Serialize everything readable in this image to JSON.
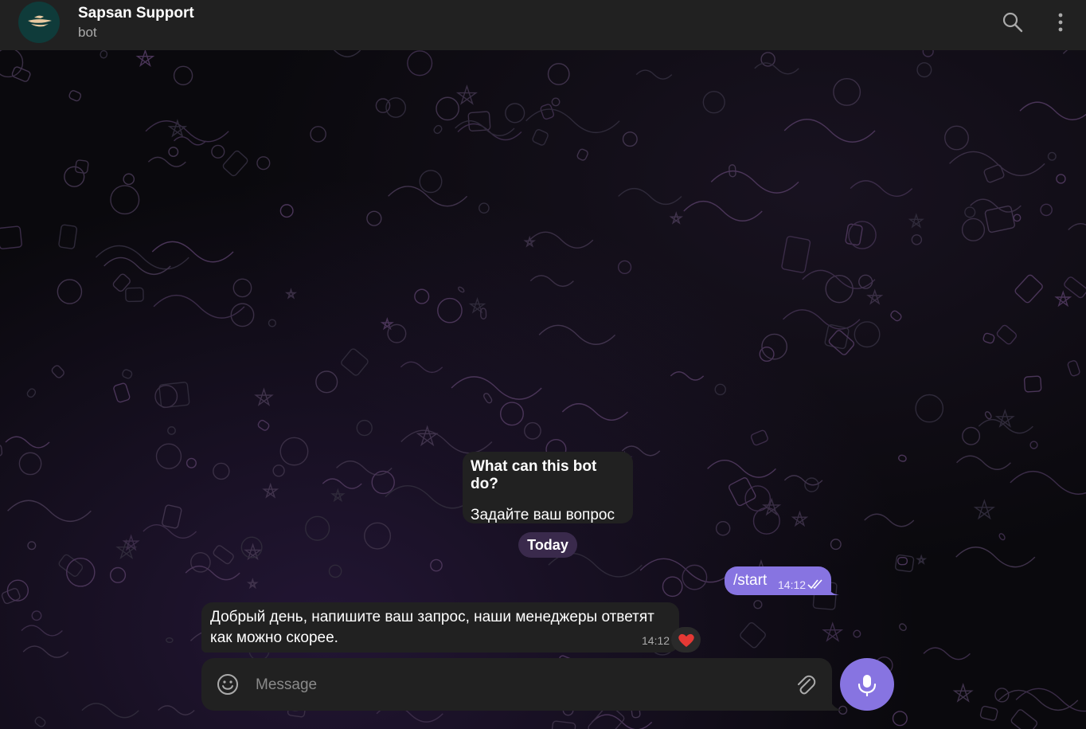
{
  "header": {
    "title": "Sapsan Support",
    "subtitle": "bot",
    "avatar_icon": "falcon-logo-icon",
    "search_icon": "search-icon",
    "menu_icon": "more-vertical-icon"
  },
  "bot_info": {
    "question": "What can this bot do?",
    "answer": "Задайте ваш вопрос"
  },
  "date_separator": "Today",
  "messages": [
    {
      "direction": "outgoing",
      "text": "/start",
      "time": "14:12",
      "status": "read-double-check"
    },
    {
      "direction": "incoming",
      "text": "Добрый день, напишите ваш запрос, наши менеджеры ответят как можно скорее.",
      "time": "14:12",
      "reaction": "❤️"
    }
  ],
  "composer": {
    "placeholder": "Message",
    "emoji_icon": "emoji-icon",
    "attach_icon": "paperclip-icon",
    "mic_icon": "microphone-icon"
  },
  "colors": {
    "accent": "#8774e1",
    "header_bg": "#212121",
    "bubble_bg": "#212121",
    "date_badge_bg": "#3a2a4c",
    "heart": "#e53935"
  }
}
